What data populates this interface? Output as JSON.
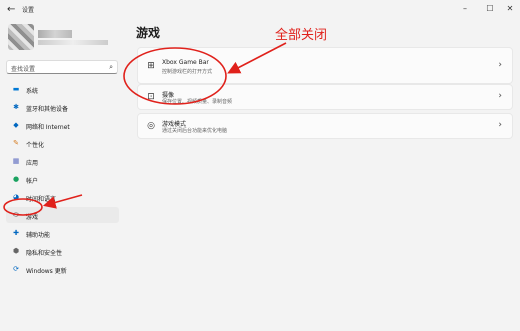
{
  "window": {
    "back_icon": "back-arrow-icon",
    "title": "设置",
    "controls": [
      "minimize-icon",
      "maximize-icon",
      "close-icon"
    ]
  },
  "search": {
    "placeholder": "查找设置",
    "icon": "search-icon"
  },
  "sidebar": {
    "items": [
      {
        "label": "系统",
        "icon": "monitor-icon",
        "active": false
      },
      {
        "label": "蓝牙和其他设备",
        "icon": "bluetooth-icon",
        "active": false
      },
      {
        "label": "网络和 Internet",
        "icon": "wifi-icon",
        "active": false
      },
      {
        "label": "个性化",
        "icon": "brush-icon",
        "active": false
      },
      {
        "label": "应用",
        "icon": "apps-icon",
        "active": false
      },
      {
        "label": "帐户",
        "icon": "person-icon",
        "active": false
      },
      {
        "label": "时间和语言",
        "icon": "globe-clock-icon",
        "active": false
      },
      {
        "label": "游戏",
        "icon": "gamepad-icon",
        "active": true
      },
      {
        "label": "辅助功能",
        "icon": "accessibility-icon",
        "active": false
      },
      {
        "label": "隐私和安全性",
        "icon": "shield-icon",
        "active": false
      },
      {
        "label": "Windows 更新",
        "icon": "update-icon",
        "active": false
      }
    ]
  },
  "main": {
    "title": "游戏",
    "cards": [
      {
        "title": "Xbox Game Bar",
        "subtitle": "控制游戏栏的打开方式",
        "icon": "xbox-game-bar-icon"
      },
      {
        "title": "摄像",
        "subtitle": "保存位置、视频质量、录制音频",
        "icon": "capture-icon"
      },
      {
        "title": "游戏模式",
        "subtitle": "通过关闭后台功能来优化电脑",
        "icon": "game-mode-icon"
      }
    ]
  },
  "annotation": {
    "text": "全部关闭",
    "color": "#e0211b"
  },
  "colors": {
    "accent": "#0067c0",
    "annotation_red": "#e0211b"
  }
}
